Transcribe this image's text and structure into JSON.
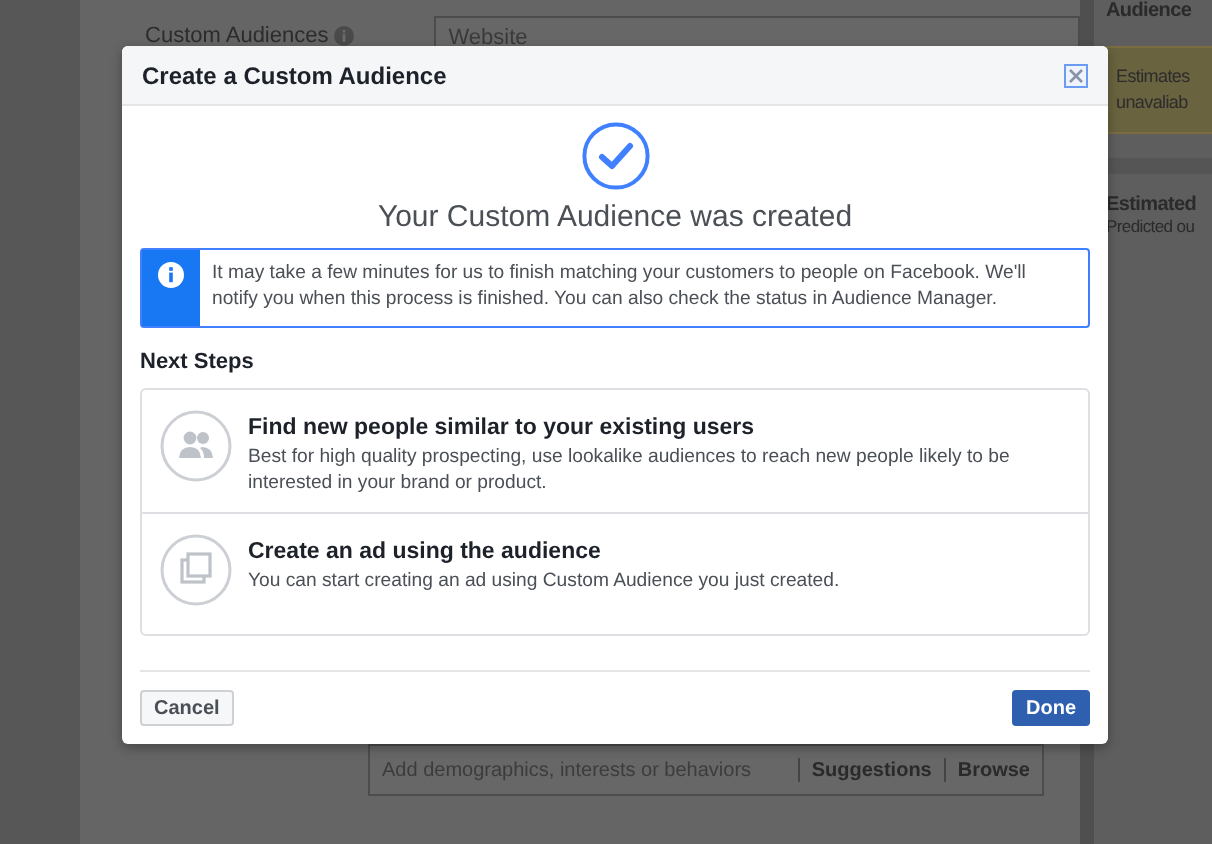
{
  "background": {
    "custom_audiences_label": "Custom Audiences",
    "website_field": {
      "value": "Website"
    },
    "right_panel": {
      "heading": "Audience",
      "notice": "Estimates unavaliab",
      "estimated_heading": "Estimated",
      "estimated_text": "Predicted ou"
    },
    "targeting_field": {
      "placeholder": "Add demographics, interests or behaviors",
      "actions": [
        "Suggestions",
        "Browse"
      ]
    }
  },
  "dialog": {
    "title": "Create a Custom Audience",
    "heading": "Your Custom Audience was created",
    "info": "It may take a few minutes for us to finish matching your customers to people on Facebook. We'll notify you when this process is finished. You can also check the status in Audience Manager.",
    "next_steps_title": "Next Steps",
    "next_steps": [
      {
        "kind": "people",
        "title": "Find new people similar to your existing users",
        "description": "Best for high quality prospecting, use lookalike audiences to reach new people likely to be interested in your brand or product."
      },
      {
        "kind": "ad",
        "title": "Create an ad using the audience",
        "description": "You can start creating an ad using Custom Audience you just created."
      }
    ],
    "buttons": [
      {
        "kind": "secondary",
        "label": "Cancel"
      },
      {
        "kind": "primary",
        "label": "Done"
      }
    ]
  }
}
